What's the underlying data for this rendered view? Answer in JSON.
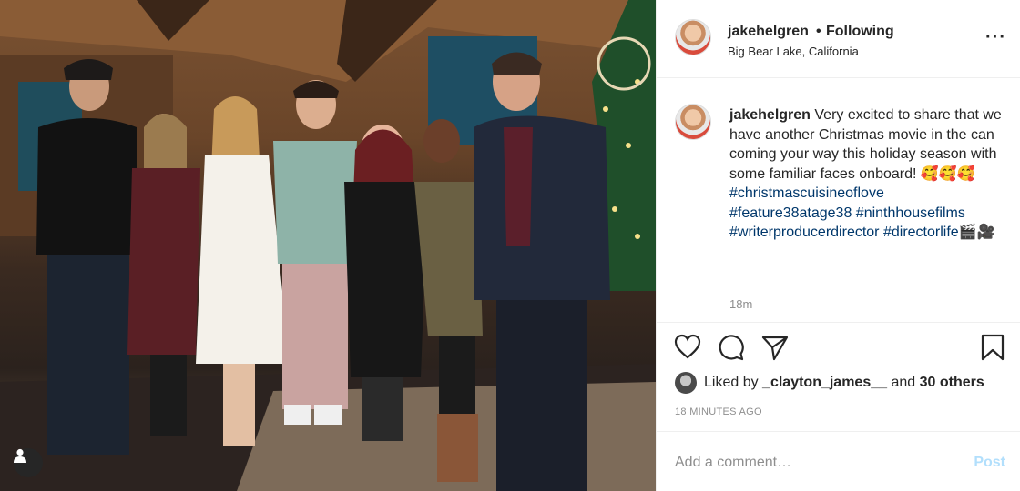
{
  "post": {
    "photo_alt": "",
    "header": {
      "username": "jakehelgren",
      "separator": "•",
      "follow_status": "Following",
      "location": "Big Bear Lake, California",
      "more_icon": "more-options-icon"
    },
    "caption": {
      "username": "jakehelgren",
      "text": " Very excited to share that we have another Christmas movie in the can coming your way this holiday season with some familiar faces onboard! 🥰🥰🥰",
      "hashtags": [
        "#christmascuisineoflove",
        "#feature38atage38",
        "#ninthhousefilms",
        "#writerproducerdirector",
        "#directorlife"
      ],
      "trailing_emoji": "🎬🎥",
      "relative_time": "18m"
    },
    "actions": {
      "like_icon": "heart-icon",
      "comment_icon": "comment-icon",
      "share_icon": "share-icon",
      "save_icon": "bookmark-icon"
    },
    "likes": {
      "prefix": "Liked by ",
      "first_user": "_clayton_james__",
      "middle": " and ",
      "others": "30 others"
    },
    "timestamp": "18 MINUTES AGO",
    "comment_box": {
      "placeholder": "Add a comment…",
      "post_label": "Post"
    }
  }
}
